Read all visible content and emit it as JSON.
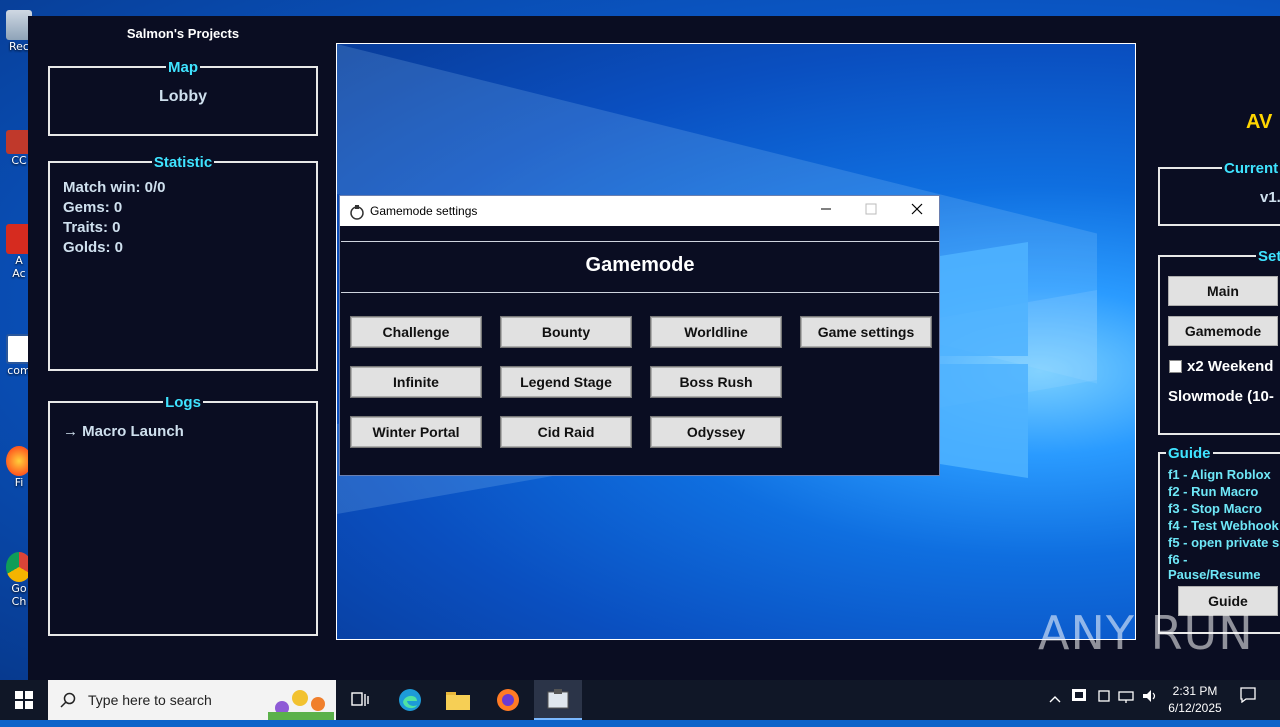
{
  "desktop": {
    "icons": [
      {
        "label": "Rec"
      },
      {
        "label": "CC"
      },
      {
        "label": "A"
      },
      {
        "label": "Ac"
      },
      {
        "label": "com"
      },
      {
        "label": "Fi"
      },
      {
        "label": "Go"
      },
      {
        "label": "Ch"
      }
    ]
  },
  "macro": {
    "title": "Salmon's Projects",
    "map": {
      "title": "Map",
      "value": "Lobby"
    },
    "statistic": {
      "title": "Statistic",
      "lines": [
        "Match win: 0/0",
        "Gems: 0",
        "Traits: 0",
        "Golds: 0"
      ]
    },
    "logs": {
      "title": "Logs",
      "entries": [
        "→ Macro Launch"
      ]
    },
    "right": {
      "app_name": "AV",
      "current": {
        "title": "Current",
        "value": "v1."
      },
      "settings": {
        "title": "Sett",
        "main_button": "Main",
        "gamemode_button": "Gamemode",
        "weekend_label": "x2 Weekend",
        "slowmode_label": "Slowmode (10-"
      },
      "guide": {
        "title": "Guide",
        "items": [
          "f1 - Align Roblox",
          "f2 - Run Macro",
          "f3 - Stop Macro",
          "f4 - Test Webhook",
          "f5 - open private s",
          "f6 - Pause/Resume"
        ],
        "button": "Guide"
      }
    }
  },
  "dialog": {
    "title": "Gamemode settings",
    "heading": "Gamemode",
    "buttons": {
      "challenge": "Challenge",
      "bounty": "Bounty",
      "worldline": "Worldline",
      "game_settings": "Game settings",
      "infinite": "Infinite",
      "legend_stage": "Legend Stage",
      "boss_rush": "Boss Rush",
      "winter_portal": "Winter Portal",
      "cid_raid": "Cid Raid",
      "odyssey": "Odyssey"
    }
  },
  "taskbar": {
    "search_placeholder": "Type here to search",
    "time": "2:31 PM",
    "date": "6/12/2025"
  },
  "watermark": "ANY RUN",
  "colors": {
    "panel_bg": "#0a0d22",
    "group_title": "#3fe3ff",
    "accent_yellow": "#ffd500",
    "button_face": "#e1e1e1"
  }
}
